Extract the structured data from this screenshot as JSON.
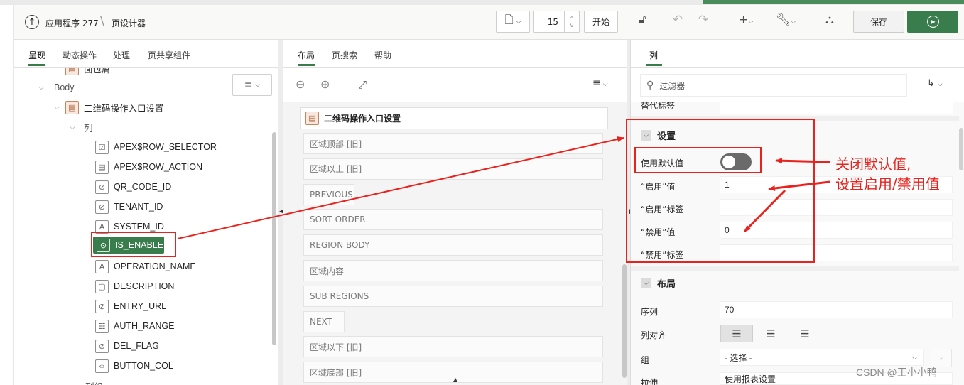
{
  "toolbar": {
    "app_label": "应用程序 277",
    "page_designer_label": "页设计器",
    "page_number": "15",
    "start_label": "开始",
    "save_label": "保存"
  },
  "left_panel": {
    "tabs": [
      "呈现",
      "动态操作",
      "处理",
      "页共享组件"
    ],
    "tree": {
      "partial_top": "面包屑",
      "body_label": "Body",
      "region_label": "二维码操作入口设置",
      "columns_label": "列",
      "columns": [
        {
          "name": "APEX$ROW_SELECTOR",
          "icon": "checkbox-icon"
        },
        {
          "name": "APEX$ROW_ACTION",
          "icon": "document-icon"
        },
        {
          "name": "QR_CODE_ID",
          "icon": "hidden-eye-icon"
        },
        {
          "name": "TENANT_ID",
          "icon": "hidden-eye-icon"
        },
        {
          "name": "SYSTEM_ID",
          "icon": "text-field-icon"
        },
        {
          "name": "IS_ENABLE",
          "icon": "switch-icon"
        },
        {
          "name": "OPERATION_NAME",
          "icon": "text-field-icon"
        },
        {
          "name": "DESCRIPTION",
          "icon": "textarea-icon"
        },
        {
          "name": "ENTRY_URL",
          "icon": "hidden-eye-icon"
        },
        {
          "name": "AUTH_RANGE",
          "icon": "list-icon"
        },
        {
          "name": "DEL_FLAG",
          "icon": "hidden-eye-icon"
        },
        {
          "name": "BUTTON_COL",
          "icon": "code-icon"
        }
      ],
      "partial_bottom": "列组"
    }
  },
  "middle_panel": {
    "tabs": [
      "布局",
      "页搜索",
      "帮助"
    ],
    "region_title": "二维码操作入口设置",
    "slots": [
      "区域顶部 [旧]",
      "区域以上 [旧]",
      "PREVIOUS",
      "SORT ORDER",
      "REGION BODY",
      "区域内容",
      "SUB REGIONS",
      "NEXT",
      "区域以下 [旧]",
      "区域底部 [旧]"
    ]
  },
  "right_panel": {
    "tab": "列",
    "filter_placeholder": "过滤器",
    "partial_top_label": "替代标签",
    "settings": {
      "title": "设置",
      "use_default_label": "使用默认值",
      "use_default_on": false,
      "on_value_label": "“启用”值",
      "on_value": "1",
      "on_label_label": "“启用”标签",
      "on_label": "",
      "off_value_label": "“禁用”值",
      "off_value": "0",
      "off_label_label": "“禁用”标签",
      "off_label": ""
    },
    "layout": {
      "title": "布局",
      "sequence_label": "序列",
      "sequence": "70",
      "alignment_label": "列对齐",
      "group_label": "组",
      "group_value": "- 选择 -",
      "stretch_label": "拉伸",
      "stretch_value": "使用报表设置"
    }
  },
  "annotations": {
    "line1": "关闭默认值,",
    "line2": "设置启用/禁用值",
    "color": "#e8231e"
  },
  "watermark": "CSDN @王小小鸭",
  "colors": {
    "accent_green": "#3a7d4d",
    "annotation_red": "#e8231e"
  }
}
